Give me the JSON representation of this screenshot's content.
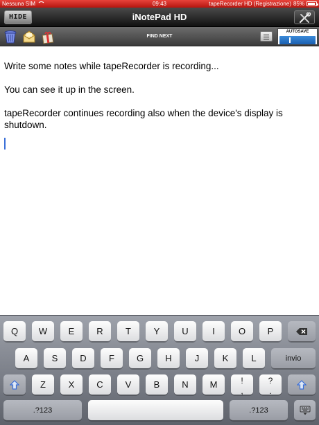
{
  "status_bar": {
    "carrier": "Nessuna SIM",
    "time": "09:43",
    "app_status": "tapeRecorder HD (Registrazione)",
    "battery": "85%"
  },
  "title_bar": {
    "hide_label": "HIDE",
    "title": "iNotePad HD"
  },
  "toolbar": {
    "find_next_label": "FIND NEXT",
    "autosave_label": "AUTOSAVE",
    "autosave_on": true
  },
  "note": {
    "lines": [
      "Write some notes while tapeRecorder is recording...",
      "You can see it up in the screen.",
      "tapeRecorder continues recording also when the device's display is",
      "shutdown."
    ]
  },
  "keyboard": {
    "row1": [
      "Q",
      "W",
      "E",
      "R",
      "T",
      "Y",
      "U",
      "I",
      "O",
      "P"
    ],
    "row2": [
      "A",
      "S",
      "D",
      "F",
      "G",
      "H",
      "J",
      "K",
      "L"
    ],
    "return_label": "invio",
    "row3": [
      "Z",
      "X",
      "C",
      "V",
      "B",
      "N",
      "M"
    ],
    "row3_punct": [
      [
        "!",
        ","
      ],
      [
        "?",
        "."
      ]
    ],
    "numbers_label": ".?123"
  },
  "colors": {
    "recording_bar": "#d22a22",
    "accent": "#2a6fc9"
  }
}
